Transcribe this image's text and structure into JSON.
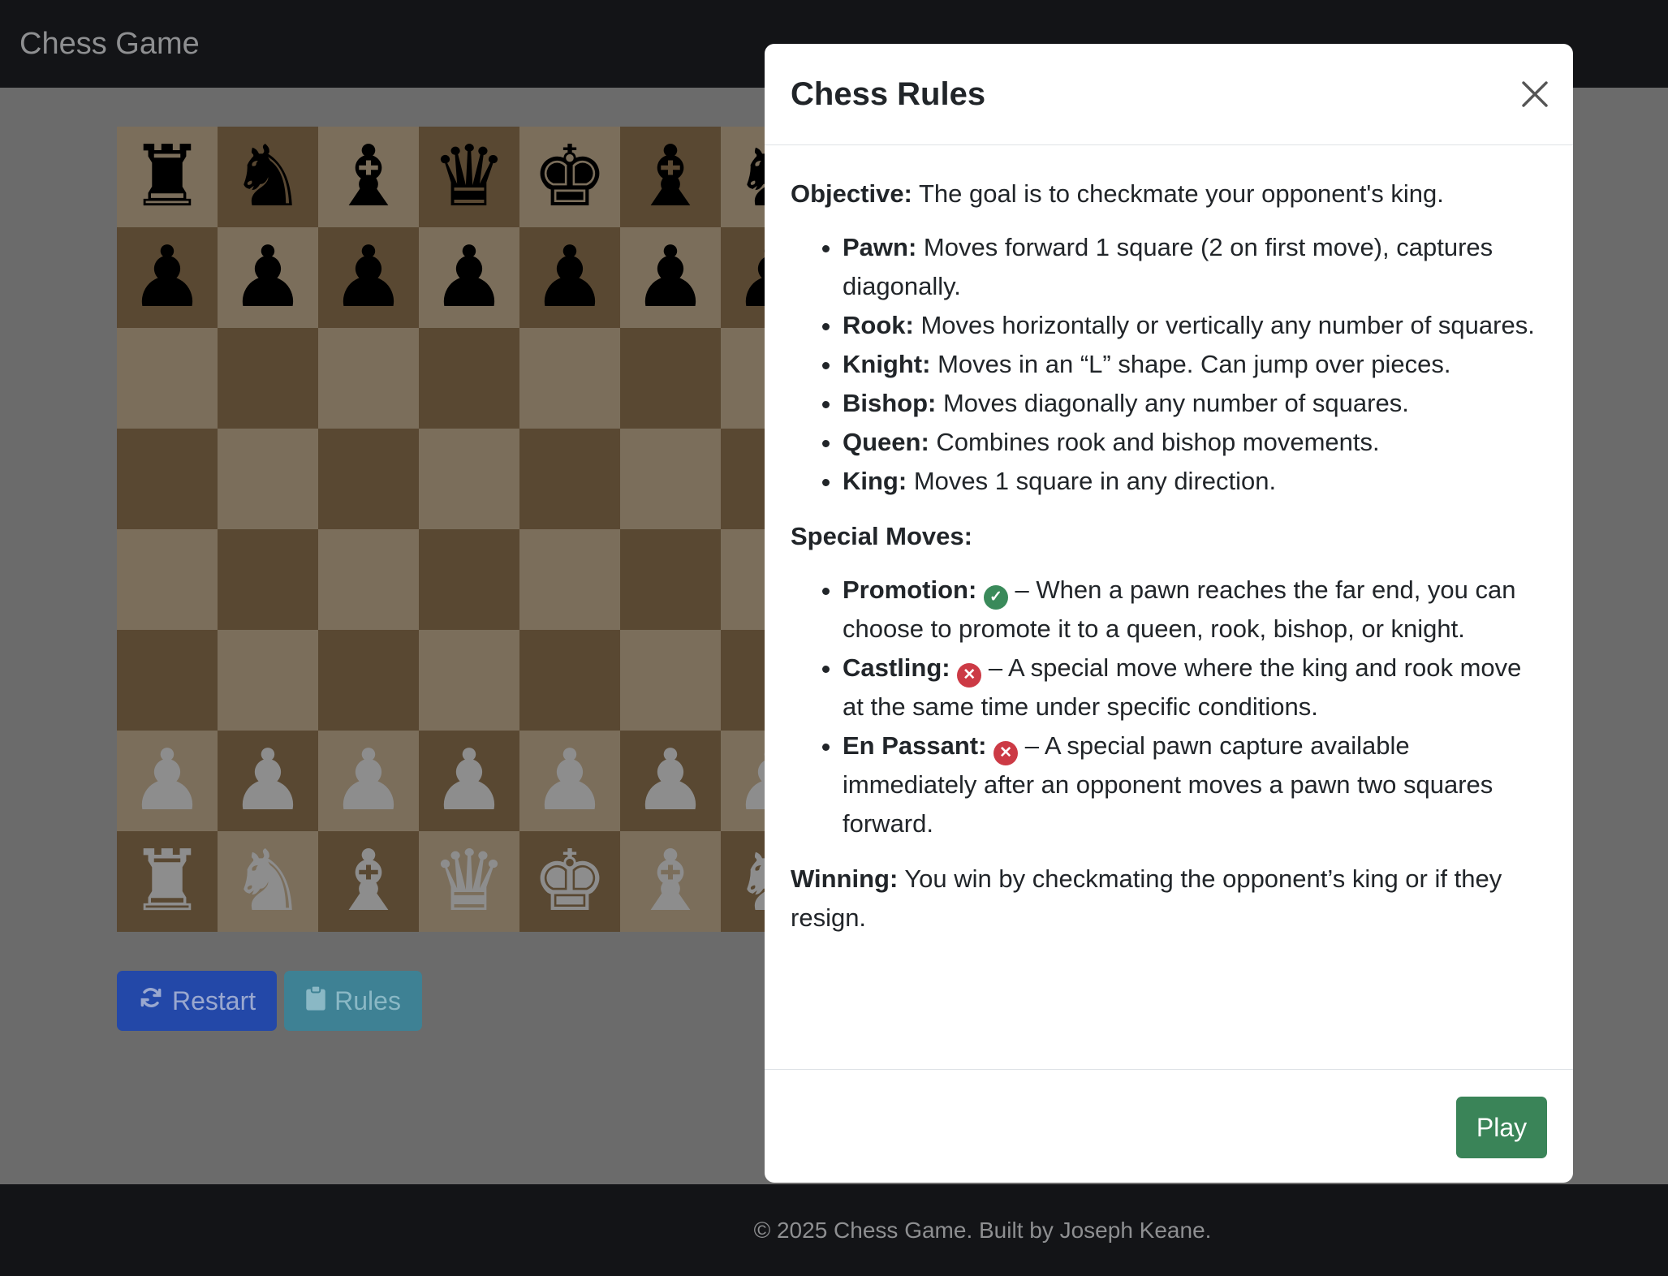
{
  "app": {
    "brand": "Chess Game"
  },
  "board": {
    "rows": [
      [
        "♜",
        "♞",
        "♝",
        "♛",
        "♚",
        "♝",
        "♞",
        "♜"
      ],
      [
        "♟",
        "♟",
        "♟",
        "♟",
        "♟",
        "♟",
        "♟",
        "♟"
      ],
      [
        "",
        "",
        "",
        "",
        "",
        "",
        "",
        ""
      ],
      [
        "",
        "",
        "",
        "",
        "",
        "",
        "",
        ""
      ],
      [
        "",
        "",
        "",
        "",
        "",
        "",
        "",
        ""
      ],
      [
        "",
        "",
        "",
        "",
        "",
        "",
        "",
        ""
      ],
      [
        "♟",
        "♟",
        "♟",
        "♟",
        "♟",
        "♟",
        "♟",
        "♟"
      ],
      [
        "♜",
        "♞",
        "♝",
        "♛",
        "♚",
        "♝",
        "♞",
        "♜"
      ]
    ],
    "colors": {
      "light": "#7b6e5b",
      "dark": "#594832",
      "black_piece": "#000000",
      "white_piece": "#8d8d8d"
    }
  },
  "controls": {
    "restart_label": "Restart",
    "rules_label": "Rules",
    "restart_icon": "refresh-icon",
    "rules_icon": "clipboard-icon"
  },
  "footer": {
    "text": "© 2025 Chess Game. Built by Joseph Keane."
  },
  "modal": {
    "title": "Chess Rules",
    "objective_label": "Objective:",
    "objective_text": " The goal is to checkmate your opponent's king.",
    "pieces": [
      {
        "name": "Pawn:",
        "desc": " Moves forward 1 square (2 on first move), captures diagonally."
      },
      {
        "name": "Rook:",
        "desc": " Moves horizontally or vertically any number of squares."
      },
      {
        "name": "Knight:",
        "desc": " Moves in an “L” shape. Can jump over pieces."
      },
      {
        "name": "Bishop:",
        "desc": " Moves diagonally any number of squares."
      },
      {
        "name": "Queen:",
        "desc": " Combines rook and bishop movements."
      },
      {
        "name": "King:",
        "desc": " Moves 1 square in any direction."
      }
    ],
    "special_heading": "Special Moves:",
    "special_moves": [
      {
        "name": "Promotion:",
        "enabled": true,
        "desc": " – When a pawn reaches the far end, you can choose to promote it to a queen, rook, bishop, or knight."
      },
      {
        "name": "Castling:",
        "enabled": false,
        "desc": " – A special move where the king and rook move at the same time under specific conditions."
      },
      {
        "name": "En Passant:",
        "enabled": false,
        "desc": " – A special pawn capture available immediately after an opponent moves a pawn two squares forward."
      }
    ],
    "winning_label": "Winning:",
    "winning_text": " You win by checkmating the opponent’s king or if they resign.",
    "play_label": "Play"
  }
}
